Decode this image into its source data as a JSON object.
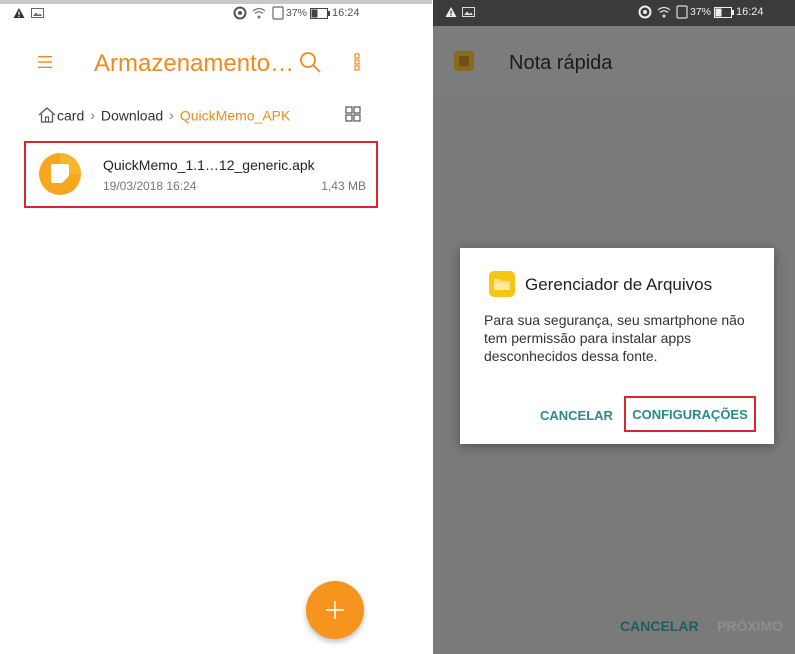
{
  "left": {
    "status_bar": {
      "battery_pct": "37%",
      "time": "16:24"
    },
    "app_title": "Armazenamento…",
    "breadcrumb": {
      "first": "card",
      "second": "Download",
      "current": "QuickMemo_APK"
    },
    "file": {
      "name": "QuickMemo_1.1…12_generic.apk",
      "date": "19/03/2018 16:24",
      "size": "1,43 MB"
    },
    "fab_label": "+",
    "accent_color": "#f08a1c"
  },
  "right": {
    "status_bar": {
      "battery_pct": "37%",
      "time": "16:24"
    },
    "toolbar_title": "Nota rápida",
    "dialog": {
      "title": "Gerenciador de Arquivos",
      "message": "Para sua segurança, seu smartphone não tem permissão para instalar apps desconhecidos dessa fonte.",
      "cancel_label": "CANCELAR",
      "settings_label": "CONFIGURAÇÕES"
    },
    "bottom_bar": {
      "cancel_label": "CANCELAR",
      "next_label": "PRÓXIMO"
    },
    "button_color": "#2a8c84"
  }
}
